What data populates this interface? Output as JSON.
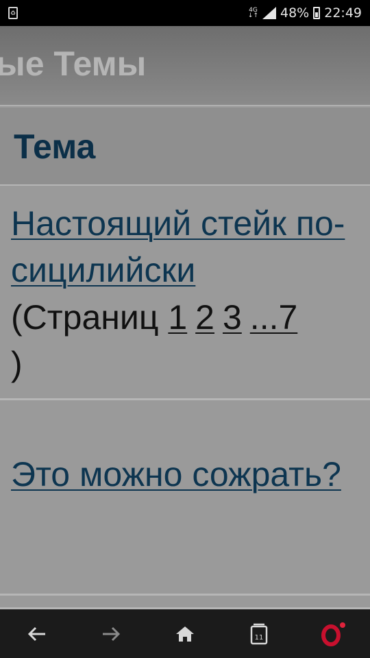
{
  "status_bar": {
    "notification_icon": "recycle-icon",
    "network": "4G",
    "battery_percent": "48%",
    "time": "22:49"
  },
  "page": {
    "header_title": "ые Темы",
    "column_header": "Тема"
  },
  "topics": [
    {
      "title": "Настоящий стейк по-сицилийски",
      "pages_prefix": "(Страниц ",
      "pages": [
        "1",
        "2",
        "3",
        "...7"
      ],
      "pages_suffix": ")"
    },
    {
      "title": "Это можно сожрать?"
    }
  ],
  "browser_nav": {
    "back_icon": "arrow-left-icon",
    "forward_icon": "arrow-right-icon",
    "home_icon": "home-icon",
    "tabs_count": "11",
    "menu_icon": "opera-logo-icon",
    "colors": {
      "opera_red": "#c8102e",
      "bar_bg": "#1b1b1b"
    }
  }
}
